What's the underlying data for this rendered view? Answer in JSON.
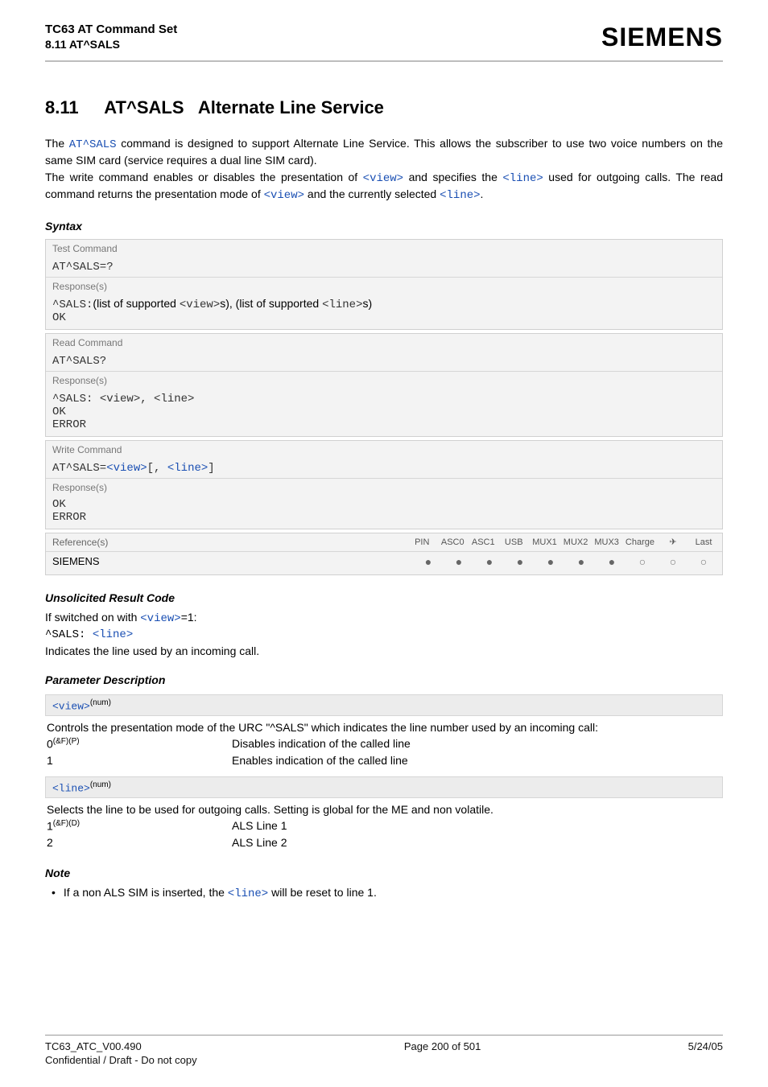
{
  "header": {
    "title": "TC63 AT Command Set",
    "subtitle": "8.11 AT^SALS",
    "brand": "SIEMENS"
  },
  "section": {
    "number": "8.11",
    "cmd": "AT^SALS",
    "title": "Alternate Line Service"
  },
  "intro": {
    "p1a": "The ",
    "p1_cmd": "AT^SALS",
    "p1b": " command is designed to support Alternate Line Service. This allows the subscriber to use two voice numbers on the same SIM card (service requires a dual line SIM card).",
    "p2a": "The write command enables or disables the presentation of ",
    "p2_view": "<view>",
    "p2b": " and specifies the ",
    "p2_line": "<line>",
    "p2c": " used for outgoing calls. The read command returns the presentation mode of ",
    "p2_view2": "<view>",
    "p2d": " and the currently selected ",
    "p2_line2": "<line>",
    "p2e": "."
  },
  "syntax_label": "Syntax",
  "test_cmd": {
    "label": "Test Command",
    "cmd": "AT^SALS=?",
    "resp_label": "Response(s)",
    "resp_prefix": "^SALS:",
    "resp_mid1": "(list of supported ",
    "resp_view": "<view>",
    "resp_mid2": "s), (list of supported ",
    "resp_line": "<line>",
    "resp_mid3": "s)",
    "ok": "OK"
  },
  "read_cmd": {
    "label": "Read Command",
    "cmd": "AT^SALS?",
    "resp_label": "Response(s)",
    "resp_prefix": "^SALS: ",
    "resp_view": "<view>",
    "resp_comma": ", ",
    "resp_line": "<line>",
    "ok": "OK",
    "error": "ERROR"
  },
  "write_cmd": {
    "label": "Write Command",
    "cmd_prefix": "AT^SALS=",
    "cmd_view": "<view>",
    "cmd_mid": "[, ",
    "cmd_line": "<line>",
    "cmd_suffix": "]",
    "resp_label": "Response(s)",
    "ok": "OK",
    "error": "ERROR"
  },
  "ref": {
    "label": "Reference(s)",
    "cols": [
      "PIN",
      "ASC0",
      "ASC1",
      "USB",
      "MUX1",
      "MUX2",
      "MUX3",
      "Charge",
      "✈",
      "Last"
    ],
    "vendor": "SIEMENS",
    "states": [
      "dot",
      "dot",
      "dot",
      "dot",
      "dot",
      "dot",
      "dot",
      "odot",
      "odot",
      "odot"
    ]
  },
  "urc": {
    "heading": "Unsolicited Result Code",
    "p1a": "If switched on with ",
    "p1_view": "<view>",
    "p1b": "=1:",
    "line_prefix": "^SALS: ",
    "line_param": "<line>",
    "p2": "Indicates the line used by an incoming call."
  },
  "pdesc_heading": "Parameter Description",
  "param_view": {
    "name": "<view>",
    "sup": "(num)",
    "desc": "Controls the presentation mode of the URC \"^SALS\" which indicates the line number used by an incoming call:",
    "rows": [
      {
        "v": "0",
        "sup": "(&F)(P)",
        "d": "Disables indication of the called line"
      },
      {
        "v": "1",
        "sup": "",
        "d": "Enables indication of the called line"
      }
    ]
  },
  "param_line": {
    "name": "<line>",
    "sup": "(num)",
    "desc": "Selects the line to be used for outgoing calls. Setting is global for the ME and non volatile.",
    "rows": [
      {
        "v": "1",
        "sup": "(&F)(D)",
        "d": "ALS Line 1"
      },
      {
        "v": "2",
        "sup": "",
        "d": "ALS Line 2"
      }
    ]
  },
  "note": {
    "heading": "Note",
    "bullet_a": "If a non ALS SIM is inserted, the ",
    "bullet_param": "<line>",
    "bullet_b": " will be reset to line 1."
  },
  "footer": {
    "left1": "TC63_ATC_V00.490",
    "left2": "Confidential / Draft - Do not copy",
    "center": "Page 200 of 501",
    "right": "5/24/05"
  }
}
